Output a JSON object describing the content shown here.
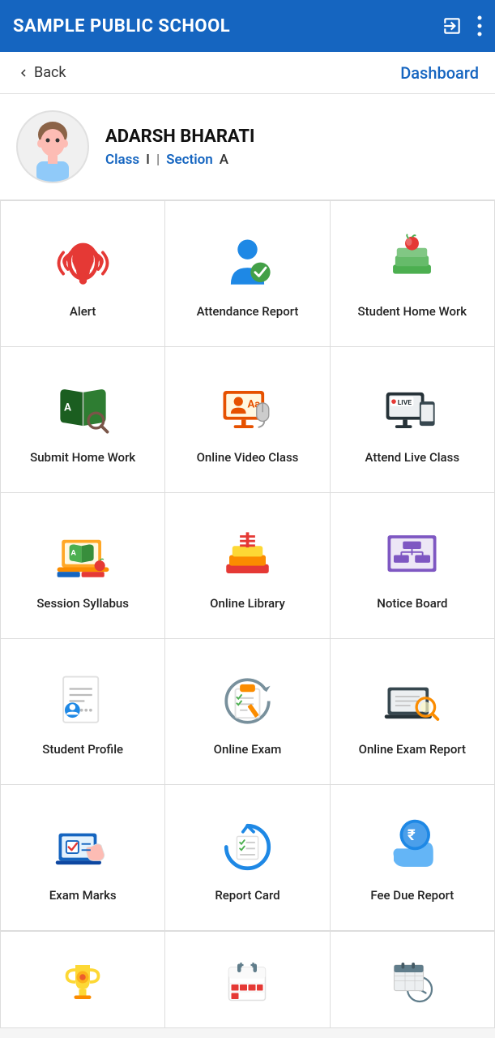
{
  "header": {
    "title": "SAMPLE PUBLIC SCHOOL",
    "logout_icon": "logout-icon",
    "more_icon": "more-icon"
  },
  "nav": {
    "back_label": "Back",
    "dashboard_label": "Dashboard"
  },
  "profile": {
    "name": "ADARSH BHARATI",
    "class_label": "Class",
    "class_value": "I",
    "section_label": "Section",
    "section_value": "A"
  },
  "grid_items": [
    {
      "id": "alert",
      "label": "Alert"
    },
    {
      "id": "attendance-report",
      "label": "Attendance Report"
    },
    {
      "id": "student-home-work",
      "label": "Student Home Work"
    },
    {
      "id": "submit-home-work",
      "label": "Submit Home Work"
    },
    {
      "id": "online-video-class",
      "label": "Online Video Class"
    },
    {
      "id": "attend-live-class",
      "label": "Attend Live Class"
    },
    {
      "id": "session-syllabus",
      "label": "Session Syllabus"
    },
    {
      "id": "online-library",
      "label": "Online Library"
    },
    {
      "id": "notice-board",
      "label": "Notice Board"
    },
    {
      "id": "student-profile",
      "label": "Student Profile"
    },
    {
      "id": "online-exam",
      "label": "Online Exam"
    },
    {
      "id": "online-exam-report",
      "label": "Online Exam Report"
    },
    {
      "id": "exam-marks",
      "label": "Exam Marks"
    },
    {
      "id": "report-card",
      "label": "Report Card"
    },
    {
      "id": "fee-due-report",
      "label": "Fee Due Report"
    }
  ],
  "partial_items": [
    {
      "id": "trophy",
      "label": ""
    },
    {
      "id": "calendar",
      "label": ""
    },
    {
      "id": "time-table",
      "label": ""
    }
  ],
  "accent_color": "#1565C0"
}
